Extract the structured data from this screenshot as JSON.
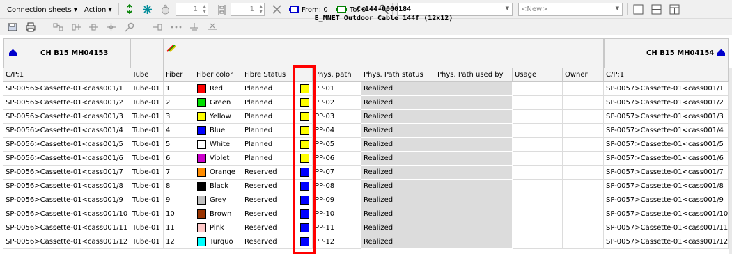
{
  "toolbar": {
    "connection_sheets": "Connection sheets",
    "action": "Action",
    "spin1": "1",
    "spin2": "1",
    "from_label": "From: 0",
    "to_label": "To: 0",
    "search_value": "",
    "new_combo": "<New>",
    "extra_combo": ""
  },
  "cable": {
    "left_end": "CH B15 MH04153",
    "right_end": "CH B15 MH04154",
    "id": "C-144-0000184",
    "description": "E_MNET Outdoor Cable 144f (12x12)"
  },
  "columns": {
    "cp_left": "C/P:1",
    "tube": "Tube",
    "fiber": "Fiber",
    "fiber_color": "Fiber color",
    "fibre_status": "Fibre Status",
    "status_swatch": "",
    "phys_path": "Phys. path",
    "phys_path_status": "Phys. Path status",
    "phys_path_used_by": "Phys. Path used by",
    "usage": "Usage",
    "owner": "Owner",
    "cp_right": "C/P:1"
  },
  "rows": [
    {
      "cp_left": "SP-0056>Cassette-01<cass001/1",
      "tube": "Tube-01",
      "fiber": "1",
      "color_name": "Red",
      "color_hex": "#ff0000",
      "fibre_status": "Planned",
      "status_color": "#ffff00",
      "phys_path": "PP-01",
      "phys_path_status": "Realized",
      "cp_right": "SP-0057>Cassette-01<cass001/1"
    },
    {
      "cp_left": "SP-0056>Cassette-01<cass001/2",
      "tube": "Tube-01",
      "fiber": "2",
      "color_name": "Green",
      "color_hex": "#00e000",
      "fibre_status": "Planned",
      "status_color": "#ffff00",
      "phys_path": "PP-02",
      "phys_path_status": "Realized",
      "cp_right": "SP-0057>Cassette-01<cass001/2"
    },
    {
      "cp_left": "SP-0056>Cassette-01<cass001/3",
      "tube": "Tube-01",
      "fiber": "3",
      "color_name": "Yellow",
      "color_hex": "#ffff00",
      "fibre_status": "Planned",
      "status_color": "#ffff00",
      "phys_path": "PP-03",
      "phys_path_status": "Realized",
      "cp_right": "SP-0057>Cassette-01<cass001/3"
    },
    {
      "cp_left": "SP-0056>Cassette-01<cass001/4",
      "tube": "Tube-01",
      "fiber": "4",
      "color_name": "Blue",
      "color_hex": "#0000ff",
      "fibre_status": "Planned",
      "status_color": "#ffff00",
      "phys_path": "PP-04",
      "phys_path_status": "Realized",
      "cp_right": "SP-0057>Cassette-01<cass001/4"
    },
    {
      "cp_left": "SP-0056>Cassette-01<cass001/5",
      "tube": "Tube-01",
      "fiber": "5",
      "color_name": "White",
      "color_hex": "#ffffff",
      "fibre_status": "Planned",
      "status_color": "#ffff00",
      "phys_path": "PP-05",
      "phys_path_status": "Realized",
      "cp_right": "SP-0057>Cassette-01<cass001/5"
    },
    {
      "cp_left": "SP-0056>Cassette-01<cass001/6",
      "tube": "Tube-01",
      "fiber": "6",
      "color_name": "Violet",
      "color_hex": "#cc00cc",
      "fibre_status": "Planned",
      "status_color": "#ffff00",
      "phys_path": "PP-06",
      "phys_path_status": "Realized",
      "cp_right": "SP-0057>Cassette-01<cass001/6"
    },
    {
      "cp_left": "SP-0056>Cassette-01<cass001/7",
      "tube": "Tube-01",
      "fiber": "7",
      "color_name": "Orange",
      "color_hex": "#ff8c00",
      "fibre_status": "Reserved",
      "status_color": "#0000ff",
      "phys_path": "PP-07",
      "phys_path_status": "Realized",
      "cp_right": "SP-0057>Cassette-01<cass001/7"
    },
    {
      "cp_left": "SP-0056>Cassette-01<cass001/8",
      "tube": "Tube-01",
      "fiber": "8",
      "color_name": "Black",
      "color_hex": "#000000",
      "fibre_status": "Reserved",
      "status_color": "#0000ff",
      "phys_path": "PP-08",
      "phys_path_status": "Realized",
      "cp_right": "SP-0057>Cassette-01<cass001/8"
    },
    {
      "cp_left": "SP-0056>Cassette-01<cass001/9",
      "tube": "Tube-01",
      "fiber": "9",
      "color_name": "Grey",
      "color_hex": "#c0c0c0",
      "fibre_status": "Reserved",
      "status_color": "#0000ff",
      "phys_path": "PP-09",
      "phys_path_status": "Realized",
      "cp_right": "SP-0057>Cassette-01<cass001/9"
    },
    {
      "cp_left": "SP-0056>Cassette-01<cass001/10",
      "tube": "Tube-01",
      "fiber": "10",
      "color_name": "Brown",
      "color_hex": "#993300",
      "fibre_status": "Reserved",
      "status_color": "#0000ff",
      "phys_path": "PP-10",
      "phys_path_status": "Realized",
      "cp_right": "SP-0057>Cassette-01<cass001/10"
    },
    {
      "cp_left": "SP-0056>Cassette-01<cass001/11",
      "tube": "Tube-01",
      "fiber": "11",
      "color_name": "Pink",
      "color_hex": "#ffc8c8",
      "fibre_status": "Reserved",
      "status_color": "#0000ff",
      "phys_path": "PP-11",
      "phys_path_status": "Realized",
      "cp_right": "SP-0057>Cassette-01<cass001/11"
    },
    {
      "cp_left": "SP-0056>Cassette-01<cass001/12",
      "tube": "Tube-01",
      "fiber": "12",
      "color_name": "Turquo",
      "color_hex": "#00ffff",
      "fibre_status": "Reserved",
      "status_color": "#0000ff",
      "phys_path": "PP-12",
      "phys_path_status": "Realized",
      "cp_right": "SP-0057>Cassette-01<cass001/12"
    }
  ],
  "icons": {
    "toolbar": [
      "refresh-icon",
      "snowflake-icon",
      "weight-icon",
      "sort-icon",
      "delete-icon",
      "from-icon",
      "to-icon",
      "search-key-icon",
      "layout-single-icon",
      "layout-split-h-icon",
      "layout-split-v-icon"
    ],
    "end_marker_color": "#0000cc"
  }
}
